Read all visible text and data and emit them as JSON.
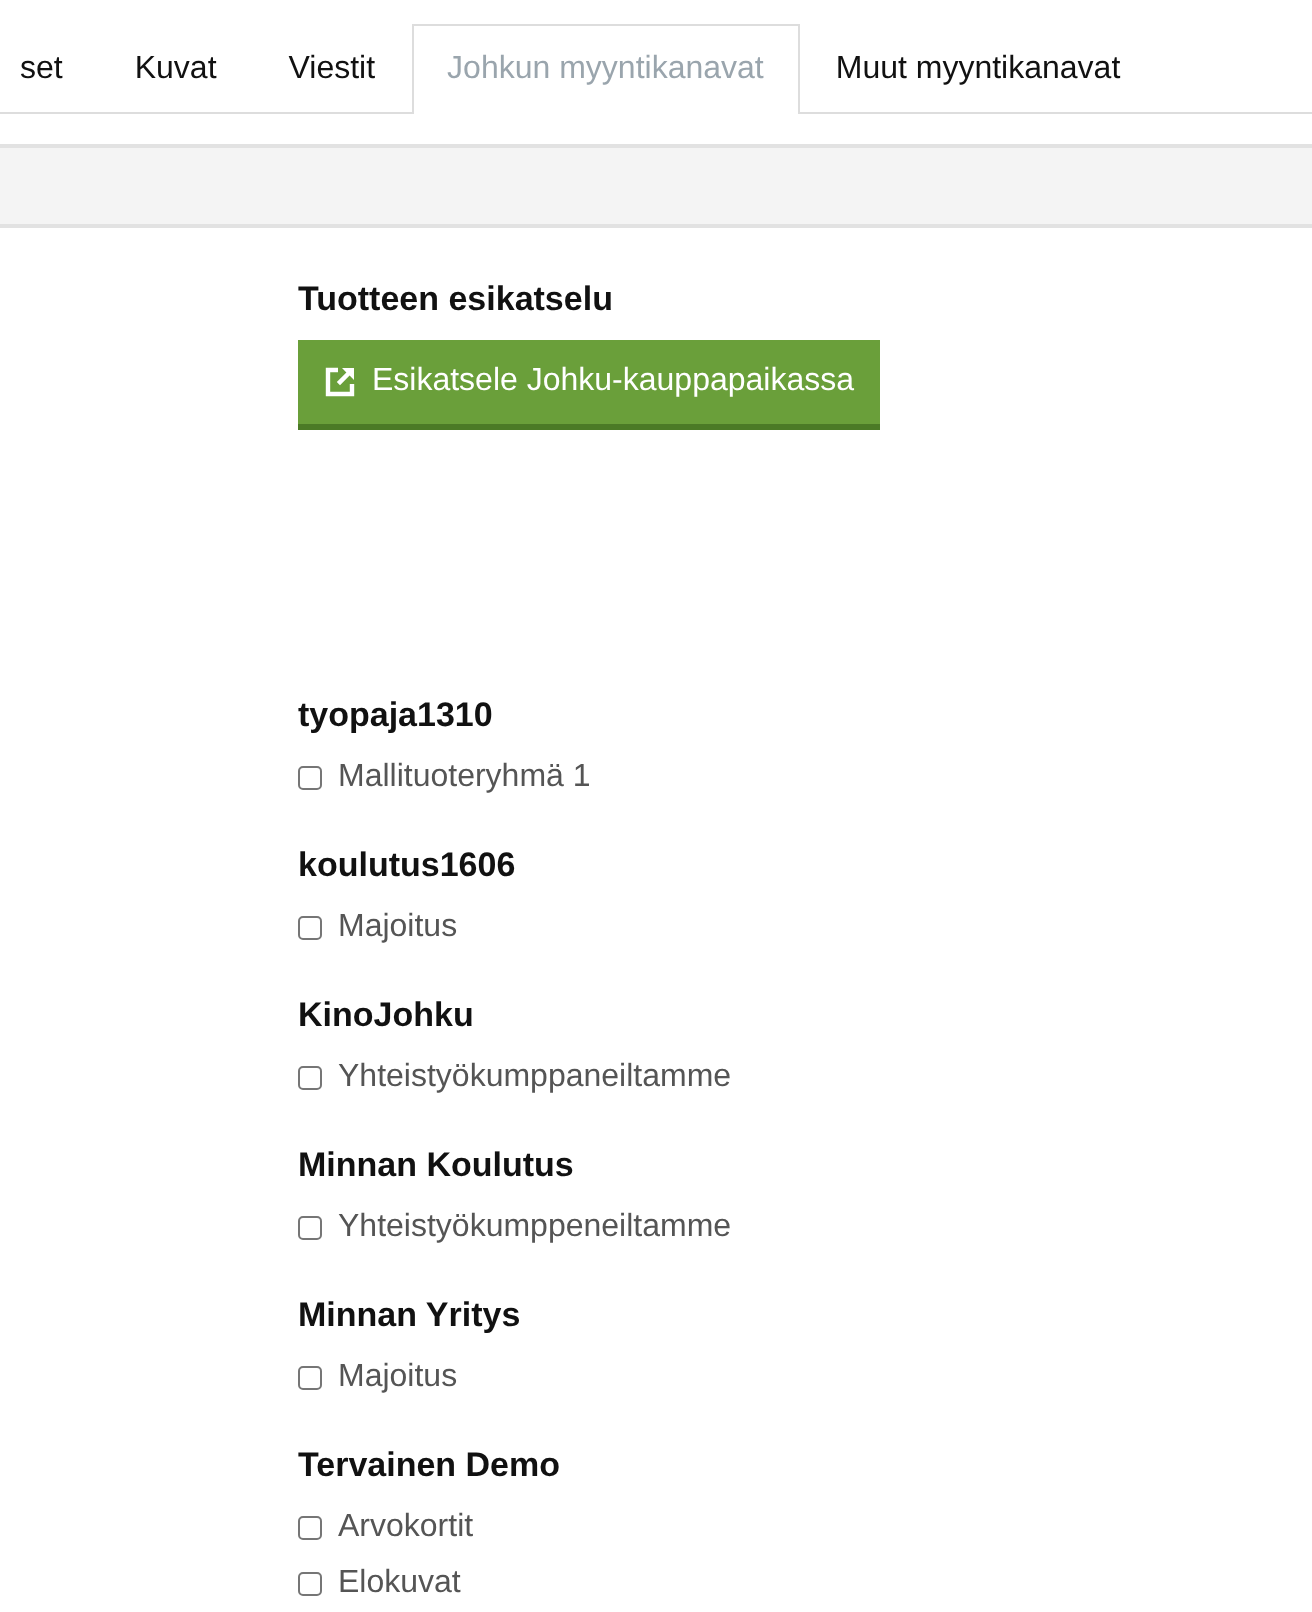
{
  "tabs": [
    {
      "label": "set",
      "selected": false
    },
    {
      "label": "Kuvat",
      "selected": false
    },
    {
      "label": "Viestit",
      "selected": false
    },
    {
      "label": "Johkun myyntikanavat",
      "selected": true
    },
    {
      "label": "Muut myyntikanavat",
      "selected": false
    }
  ],
  "preview": {
    "heading": "Tuotteen esikatselu",
    "button": "Esikatsele Johku-kauppapaikassa"
  },
  "groups": [
    {
      "name": "tyopaja1310",
      "options": [
        {
          "label": "Mallituoteryhmä 1",
          "checked": false
        }
      ]
    },
    {
      "name": "koulutus1606",
      "options": [
        {
          "label": "Majoitus",
          "checked": false
        }
      ]
    },
    {
      "name": "KinoJohku",
      "options": [
        {
          "label": "Yhteistyökumppaneiltamme",
          "checked": false
        }
      ]
    },
    {
      "name": "Minnan Koulutus",
      "options": [
        {
          "label": "Yhteistyökumppeneiltamme",
          "checked": false
        }
      ]
    },
    {
      "name": "Minnan Yritys",
      "options": [
        {
          "label": "Majoitus",
          "checked": false
        }
      ]
    },
    {
      "name": "Tervainen Demo",
      "options": [
        {
          "label": "Arvokortit",
          "checked": false
        },
        {
          "label": "Elokuvat",
          "checked": false
        }
      ]
    }
  ]
}
